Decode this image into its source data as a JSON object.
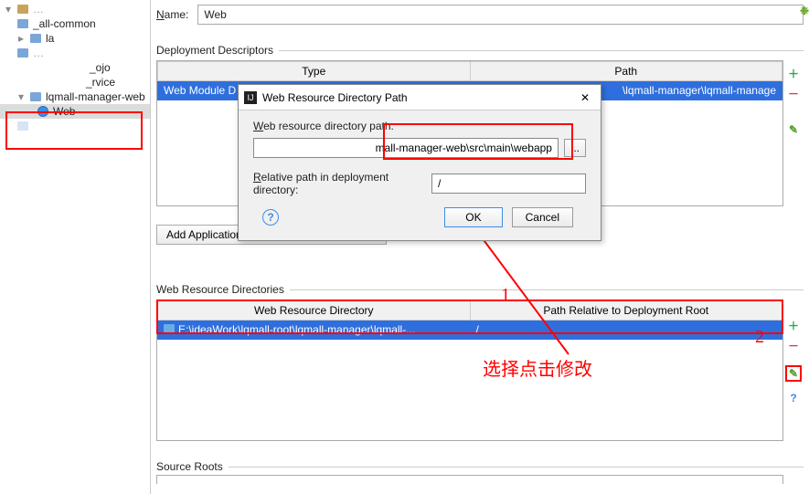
{
  "sidebar": {
    "items": [
      {
        "label": "_all-common"
      },
      {
        "label": "la"
      },
      {
        "label": "_ojo"
      },
      {
        "label": "_rvice"
      },
      {
        "label": "lqmall-manager-web"
      },
      {
        "label": "Web"
      }
    ]
  },
  "form": {
    "name_label": "Name:",
    "name_value": "Web"
  },
  "section1": {
    "title": "Deployment Descriptors",
    "col1": "Type",
    "col2": "Path",
    "row_type": "Web Module D",
    "row_path": "\\lqmall-manager\\lqmall-manage",
    "add_button": "Add Application Server specific descriptor..."
  },
  "section2": {
    "title": "Web Resource Directories",
    "col1": "Web Resource Directory",
    "col2": "Path Relative to Deployment Root",
    "row_dir": "E:\\ideaWork\\lqmall-root\\lqmall-manager\\lqmall-...",
    "row_path": "/"
  },
  "section3": {
    "title": "Source Roots"
  },
  "dialog": {
    "title": "Web Resource Directory Path",
    "field1_label": "Web resource directory path:",
    "field1_value": "mall-manager-web\\src\\main\\webapp",
    "field2_label": "Relative path in deployment directory:",
    "field2_value": "/",
    "browse": "...",
    "ok": "OK",
    "cancel": "Cancel"
  },
  "annot": {
    "num1": "1",
    "num2": "2",
    "text": "选择点击修改"
  }
}
